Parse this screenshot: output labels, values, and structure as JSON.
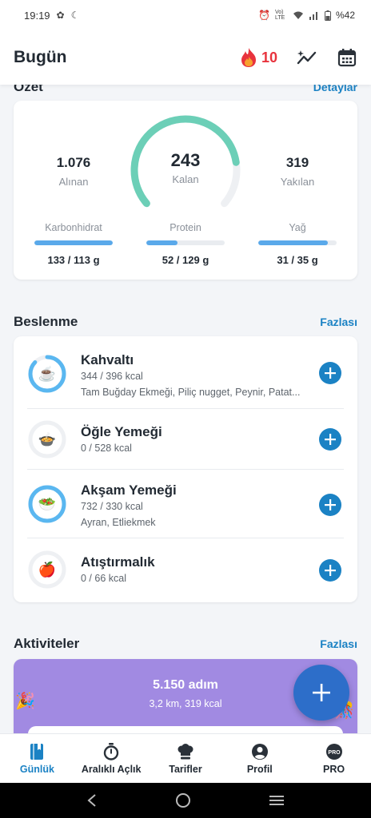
{
  "status_bar": {
    "time": "19:19",
    "battery": "%42",
    "network": "Vo) LTE"
  },
  "header": {
    "title": "Bugün",
    "streak": "10"
  },
  "summary": {
    "title": "Özet",
    "link": "Detaylar",
    "eaten": {
      "value": "1.076",
      "label": "Alınan"
    },
    "remaining": {
      "value": "243",
      "label": "Kalan"
    },
    "burned": {
      "value": "319",
      "label": "Yakılan"
    },
    "macros": [
      {
        "label": "Karbonhidrat",
        "value": "133 / 113 g",
        "progress": 1.0
      },
      {
        "label": "Protein",
        "value": "52 / 129 g",
        "progress": 0.4
      },
      {
        "label": "Yağ",
        "value": "31 / 35 g",
        "progress": 0.89
      }
    ],
    "ring_progress": 0.81
  },
  "nutrition": {
    "title": "Beslenme",
    "link": "Fazlası",
    "meals": [
      {
        "name": "Kahvaltı",
        "kcal": "344 / 396 kcal",
        "items": "Tam Buğday Ekmeği, Piliç nugget, Peynir, Patat...",
        "icon": "coffee-cup-icon",
        "progress": 0.87
      },
      {
        "name": "Öğle Yemeği",
        "kcal": "0 / 528 kcal",
        "items": "",
        "icon": "cooking-pot-icon",
        "progress": 0
      },
      {
        "name": "Akşam Yemeği",
        "kcal": "732 / 330 kcal",
        "items": "Ayran, Etliekmek",
        "icon": "salad-bowl-icon",
        "progress": 1.0
      },
      {
        "name": "Atıştırmalık",
        "kcal": "0 / 66 kcal",
        "items": "",
        "icon": "apple-icon",
        "progress": 0
      }
    ]
  },
  "activities": {
    "title": "Aktiviteler",
    "link": "Fazlası",
    "steps": "5.150 adım",
    "details": "3,2 km, 319 kcal"
  },
  "bottom_nav": [
    {
      "label": "Günlük",
      "icon": "diary-icon",
      "active": true
    },
    {
      "label": "Aralıklı Açlık",
      "icon": "stopwatch-icon",
      "active": false
    },
    {
      "label": "Tarifler",
      "icon": "chef-hat-icon",
      "active": false
    },
    {
      "label": "Profil",
      "icon": "profile-icon",
      "active": false
    },
    {
      "label": "PRO",
      "icon": "pro-badge-icon",
      "active": false
    }
  ],
  "colors": {
    "accent": "#1b82c4",
    "ring": "#6ccfb7",
    "macro_fill": "#5aa9ea",
    "streak": "#e8333d",
    "activity_card": "#a18ae2",
    "fab": "#2d6ec9"
  }
}
